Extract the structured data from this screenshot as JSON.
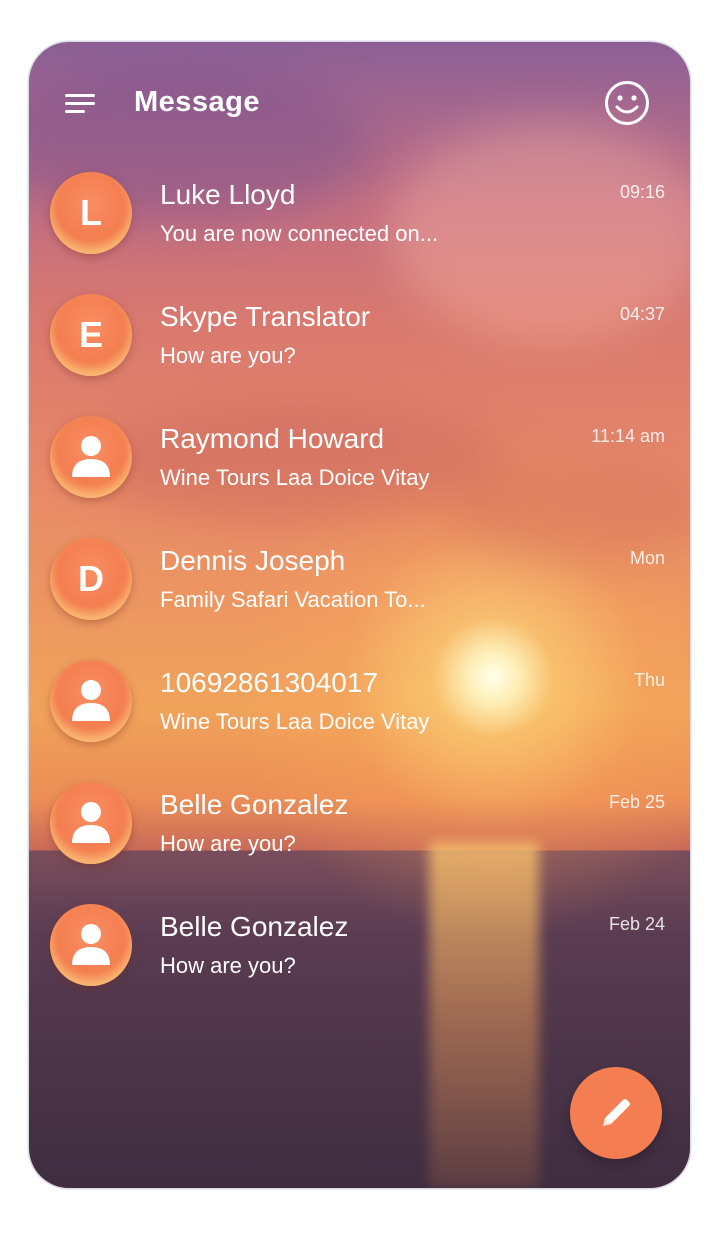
{
  "header": {
    "title": "Message",
    "menu_icon": "hamburger-menu-icon",
    "profile_icon": "smiley-face-icon"
  },
  "conversations": [
    {
      "avatar": "L",
      "avatar_type": "letter",
      "name": "Luke Lloyd",
      "preview": "You are now connected on...",
      "time": "09:16"
    },
    {
      "avatar": "E",
      "avatar_type": "letter",
      "name": "Skype Translator",
      "preview": "How are you?",
      "time": "04:37"
    },
    {
      "avatar": "",
      "avatar_type": "person-icon",
      "name": "Raymond Howard",
      "preview": "Wine Tours Laa Doice Vitay",
      "time": "11:14 am"
    },
    {
      "avatar": "D",
      "avatar_type": "letter",
      "name": "Dennis Joseph",
      "preview": "Family Safari Vacation To...",
      "time": "Mon"
    },
    {
      "avatar": "",
      "avatar_type": "person-icon",
      "name": "10692861304017",
      "preview": "Wine Tours Laa Doice Vitay",
      "time": "Thu"
    },
    {
      "avatar": "",
      "avatar_type": "person-icon",
      "name": "Belle Gonzalez",
      "preview": "How are you?",
      "time": "Feb 25"
    },
    {
      "avatar": "",
      "avatar_type": "person-icon",
      "name": "Belle Gonzalez",
      "preview": "How are you?",
      "time": "Feb 24"
    }
  ],
  "fab": {
    "icon": "pencil-edit-icon"
  },
  "colors": {
    "accent": "#f47e52",
    "text": "#ffffff"
  }
}
